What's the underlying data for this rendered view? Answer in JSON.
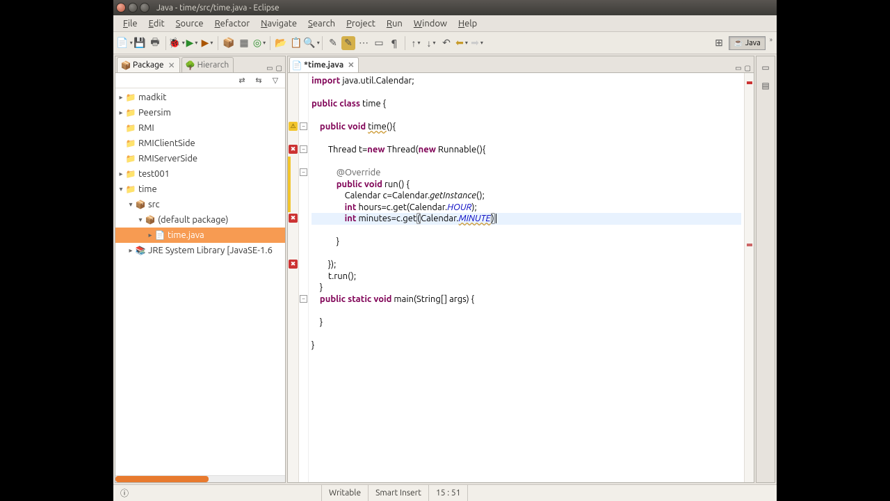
{
  "title": "Java - time/src/time.java - Eclipse",
  "menus": [
    "File",
    "Edit",
    "Source",
    "Refactor",
    "Navigate",
    "Search",
    "Project",
    "Run",
    "Window",
    "Help"
  ],
  "perspective": "Java",
  "leftTabs": {
    "package": "Package",
    "hierarch": "Hierarch"
  },
  "tree": {
    "madkit": "madkit",
    "peersim": "Peersim",
    "rmi": "RMI",
    "rmiclient": "RMIClientSide",
    "rmiserver": "RMIServerSide",
    "test001": "test001",
    "time": "time",
    "src": "src",
    "defpkg": "(default package)",
    "file": "time.java",
    "jre": "JRE System Library [JavaSE-1.6"
  },
  "editorTab": "*time.java",
  "code": [
    {
      "indent": 0,
      "segs": [
        {
          "t": "import",
          "c": "kw"
        },
        {
          "t": " java.util.Calendar;"
        }
      ]
    },
    {
      "indent": 0,
      "segs": []
    },
    {
      "indent": 0,
      "segs": [
        {
          "t": "public class",
          "c": "kw"
        },
        {
          "t": " time {"
        }
      ]
    },
    {
      "indent": 0,
      "segs": []
    },
    {
      "indent": 1,
      "segs": [
        {
          "t": "public void",
          "c": "kw"
        },
        {
          "t": " "
        },
        {
          "t": "time",
          "u": true
        },
        {
          "t": "(){"
        }
      ]
    },
    {
      "indent": 0,
      "segs": []
    },
    {
      "indent": 2,
      "segs": [
        {
          "t": "Thread t="
        },
        {
          "t": "new",
          "c": "kw"
        },
        {
          "t": " Thread("
        },
        {
          "t": "new",
          "c": "kw"
        },
        {
          "t": " Runnable(){"
        }
      ]
    },
    {
      "indent": 0,
      "segs": []
    },
    {
      "indent": 3,
      "segs": [
        {
          "t": "@Override",
          "c": "ann"
        }
      ]
    },
    {
      "indent": 3,
      "segs": [
        {
          "t": "public void",
          "c": "kw"
        },
        {
          "t": " run() {"
        }
      ]
    },
    {
      "indent": 4,
      "segs": [
        {
          "t": "Calendar c=Calendar."
        },
        {
          "t": "getInstance",
          "c": "it"
        },
        {
          "t": "();"
        }
      ]
    },
    {
      "indent": 4,
      "segs": [
        {
          "t": "int",
          "c": "kw"
        },
        {
          "t": " hours=c.get(Calendar."
        },
        {
          "t": "HOUR",
          "c": "itc"
        },
        {
          "t": ");"
        }
      ]
    },
    {
      "indent": 4,
      "hl": true,
      "segs": [
        {
          "t": "int",
          "c": "kw"
        },
        {
          "t": " minutes=c.get"
        },
        {
          "t": "(",
          "box": true
        },
        {
          "t": "Calendar."
        },
        {
          "t": "MINUTE",
          "c": "itc",
          "u": true
        },
        {
          "t": ")",
          "box": true
        },
        {
          "t": "|",
          "caret": true
        }
      ]
    },
    {
      "indent": 0,
      "segs": []
    },
    {
      "indent": 3,
      "segs": [
        {
          "t": "}"
        }
      ]
    },
    {
      "indent": 0,
      "segs": []
    },
    {
      "indent": 2,
      "segs": [
        {
          "t": "});"
        }
      ]
    },
    {
      "indent": 2,
      "segs": [
        {
          "t": "t.run();"
        }
      ]
    },
    {
      "indent": 1,
      "segs": [
        {
          "t": "}"
        }
      ]
    },
    {
      "indent": 1,
      "segs": [
        {
          "t": "public static void",
          "c": "kw"
        },
        {
          "t": " main(String[] args) {"
        }
      ]
    },
    {
      "indent": 0,
      "segs": []
    },
    {
      "indent": 1,
      "segs": [
        {
          "t": "}"
        }
      ]
    },
    {
      "indent": 0,
      "segs": []
    },
    {
      "indent": 0,
      "segs": [
        {
          "t": "}"
        }
      ]
    }
  ],
  "status": {
    "writable": "Writable",
    "insert": "Smart Insert",
    "pos": "15 : 51"
  }
}
